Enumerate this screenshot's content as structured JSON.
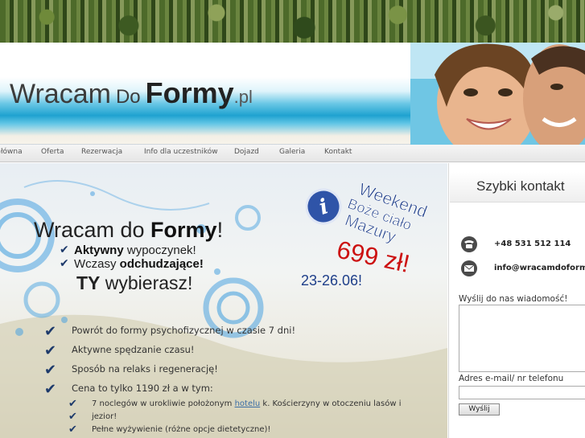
{
  "logo": {
    "part1": "Wracam",
    "part2": "Do",
    "part3": "Formy",
    "part4": ".pl"
  },
  "nav": [
    {
      "label": "Główna"
    },
    {
      "label": "Oferta"
    },
    {
      "label": "Rezerwacja"
    },
    {
      "label": "Info dla uczestników"
    },
    {
      "label": "Dojazd"
    },
    {
      "label": "Galeria"
    },
    {
      "label": "Kontakt"
    }
  ],
  "hero": {
    "title_a": "Wracam do ",
    "title_b": "Formy",
    "title_c": "!",
    "line1_a": "Aktywny",
    "line1_b": " wypoczynek!",
    "line2_a": "Wczasy ",
    "line2_b": "odchudzające!",
    "line3_a": "TY",
    "line3_b": " wybierasz!"
  },
  "promo": {
    "line1": "Weekend",
    "line2": "Boże ciało",
    "line3": "Mazury",
    "price": "699 zł!",
    "dates": "23-26.06!"
  },
  "features": [
    "Powrót do formy psychofizycznej w czasie 7 dni!",
    "Aktywne spędzanie czasu!",
    "Sposób na relaks i regenerację!",
    "Cena to tylko 1190 zł a w tym:"
  ],
  "details": {
    "item1_a": "7 noclegów w urokliwie położonym ",
    "item1_link": "hotelu",
    "item1_b": " k. Kościerzyny w otoczeniu lasów i",
    "item1_c": "jezior!",
    "item2": "Pełne wyżywienie (różne opcje dietetyczne)!"
  },
  "sidebar": {
    "title": "Szybki kontakt",
    "phone": "+48 531 512 114",
    "email": "info@wracamdoformy.pl",
    "message_label": "Wyślij do nas wiadomość!",
    "address_label": "Adres e-mail/ nr telefonu",
    "send_label": "Wyślij"
  },
  "colors": {
    "accent": "#1f3f8a",
    "price": "#cc1111",
    "check": "#1d3a6b"
  }
}
